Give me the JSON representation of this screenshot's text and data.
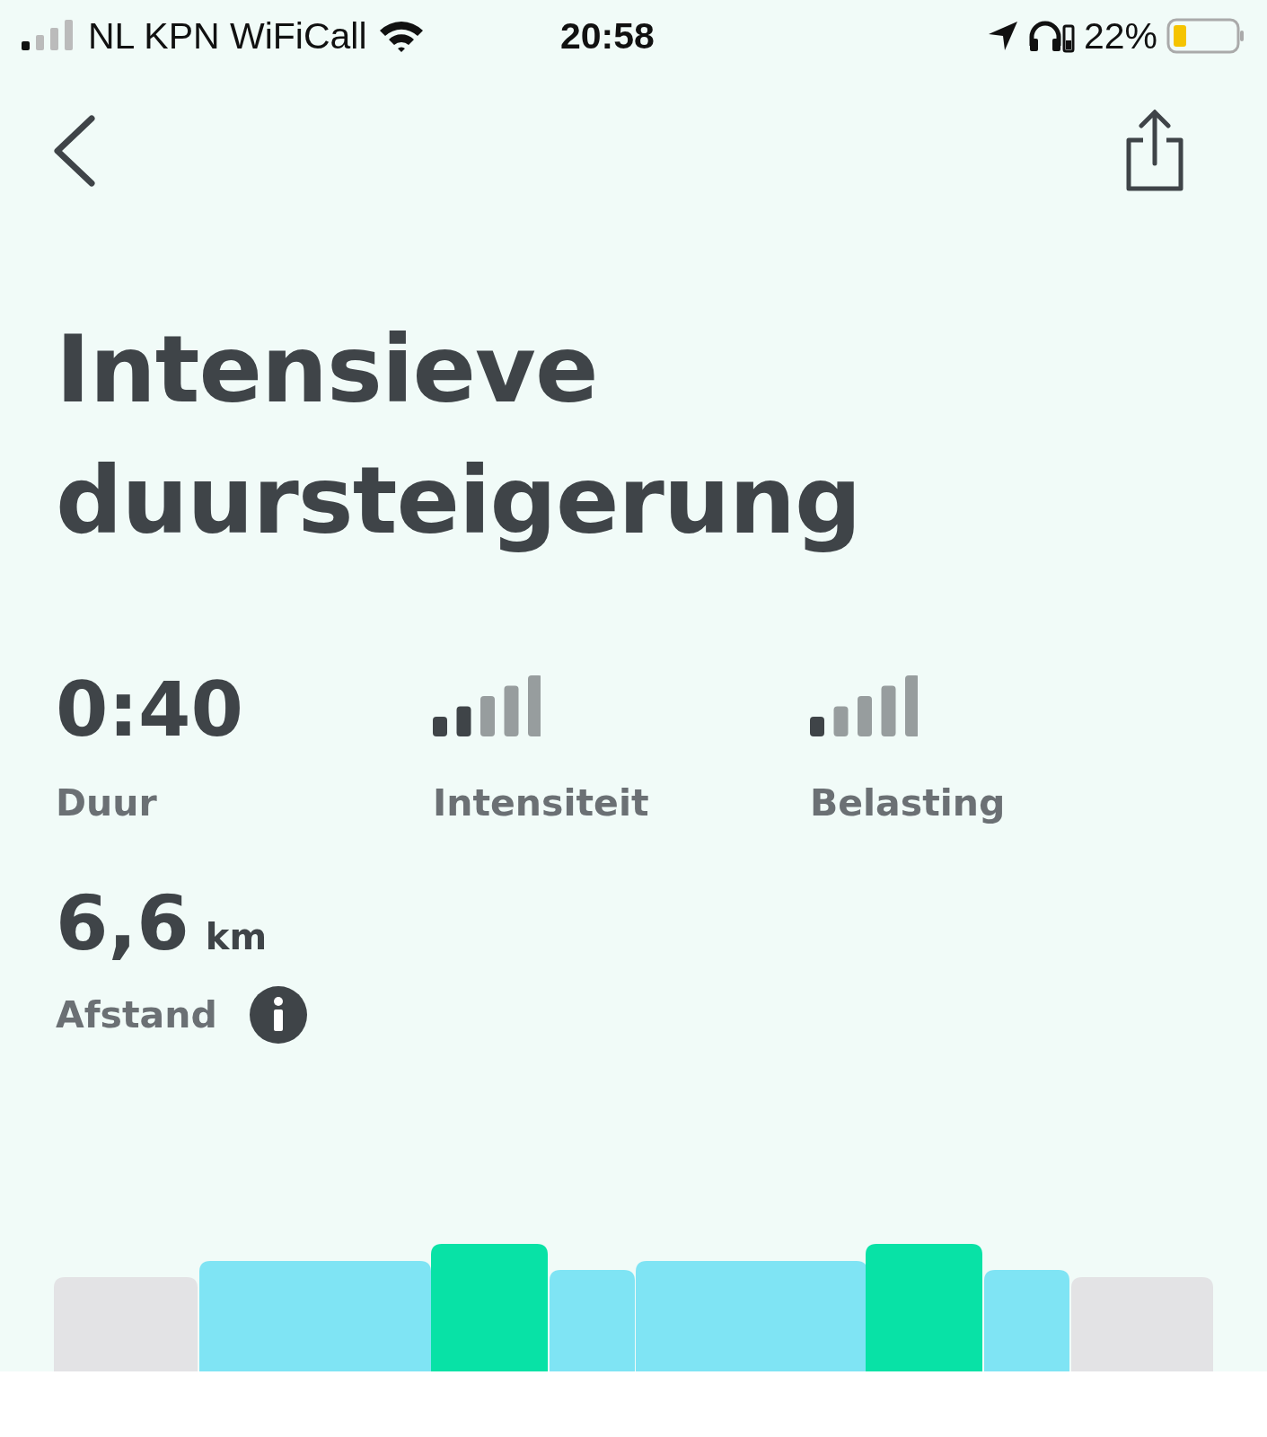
{
  "status_bar": {
    "carrier": "NL KPN WiFiCall",
    "time": "20:58",
    "battery": "22%"
  },
  "title": "Intensieve duursteigerung",
  "stats": [
    {
      "kind": "value",
      "value": "0:40",
      "label": "Duur"
    },
    {
      "kind": "bars",
      "level": 0.4,
      "label": "Intensiteit"
    },
    {
      "kind": "bars",
      "level": 0.2,
      "label": "Belasting"
    }
  ],
  "distance": {
    "value": "6,6",
    "unit": "km",
    "label": "Afstand"
  }
}
